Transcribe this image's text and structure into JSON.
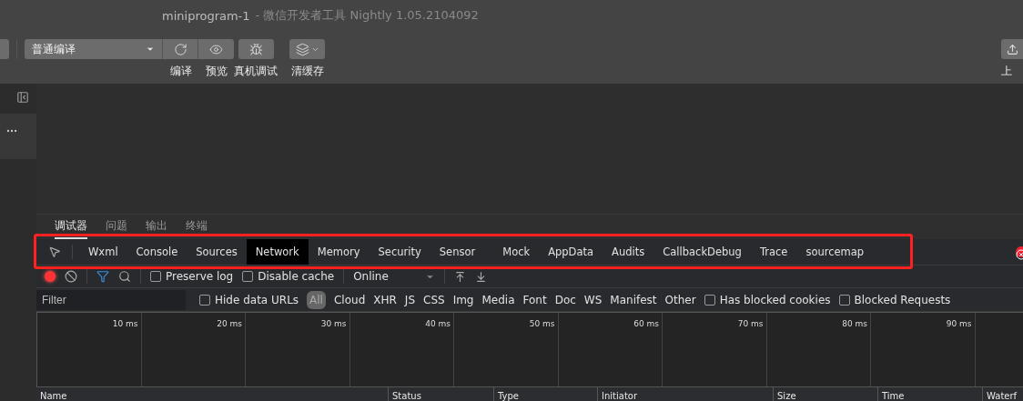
{
  "window": {
    "title": "miniprogram-1",
    "subtitle": "- 微信开发者工具 Nightly 1.05.2104092"
  },
  "toolbar": {
    "compile_mode": "普通编译",
    "tools": [
      {
        "kind": "refresh",
        "label": "编译"
      },
      {
        "kind": "preview",
        "label": "预览"
      },
      {
        "kind": "bug",
        "label": "真机调试"
      },
      {
        "kind": "layers",
        "label": "清缓存"
      }
    ],
    "upload": {
      "label": "上"
    }
  },
  "bottom_tabs": [
    {
      "label": "调试器",
      "selected": true
    },
    {
      "label": "问题",
      "selected": false
    },
    {
      "label": "输出",
      "selected": false
    },
    {
      "label": "终端",
      "selected": false
    }
  ],
  "devtools_tabs": [
    {
      "label": "Wxml",
      "selected": false
    },
    {
      "label": "Console",
      "selected": false
    },
    {
      "label": "Sources",
      "selected": false
    },
    {
      "label": "Network",
      "selected": true
    },
    {
      "label": "Memory",
      "selected": false
    },
    {
      "label": "Security",
      "selected": false
    },
    {
      "label": "Sensor",
      "selected": false
    },
    {
      "label": "Mock",
      "selected": false
    },
    {
      "label": "AppData",
      "selected": false
    },
    {
      "label": "Audits",
      "selected": false
    },
    {
      "label": "CallbackDebug",
      "selected": false
    },
    {
      "label": "Trace",
      "selected": false
    },
    {
      "label": "sourcemap",
      "selected": false
    }
  ],
  "network": {
    "recording": true,
    "options": [
      {
        "label": "Preserve log",
        "checked": false
      },
      {
        "label": "Disable cache",
        "checked": false
      }
    ],
    "throttling": "Online",
    "filter": {
      "placeholder": "Filter",
      "hide_data_urls": {
        "label": "Hide data URLs",
        "checked": false
      },
      "types": [
        {
          "label": "All",
          "selected": true
        },
        {
          "label": "Cloud",
          "selected": false
        },
        {
          "label": "XHR",
          "selected": false
        },
        {
          "label": "JS",
          "selected": false
        },
        {
          "label": "CSS",
          "selected": false
        },
        {
          "label": "Img",
          "selected": false
        },
        {
          "label": "Media",
          "selected": false
        },
        {
          "label": "Font",
          "selected": false
        },
        {
          "label": "Doc",
          "selected": false
        },
        {
          "label": "WS",
          "selected": false
        },
        {
          "label": "Manifest",
          "selected": false
        },
        {
          "label": "Other",
          "selected": false
        }
      ],
      "extra": [
        {
          "label": "Has blocked cookies",
          "checked": false
        },
        {
          "label": "Blocked Requests",
          "checked": false
        }
      ]
    },
    "timeline_ticks": [
      "10 ms",
      "20 ms",
      "30 ms",
      "40 ms",
      "50 ms",
      "60 ms",
      "70 ms",
      "80 ms",
      "90 ms"
    ],
    "columns": [
      "Name",
      "Status",
      "Type",
      "Initiator",
      "Size",
      "Time",
      "Waterf"
    ]
  }
}
